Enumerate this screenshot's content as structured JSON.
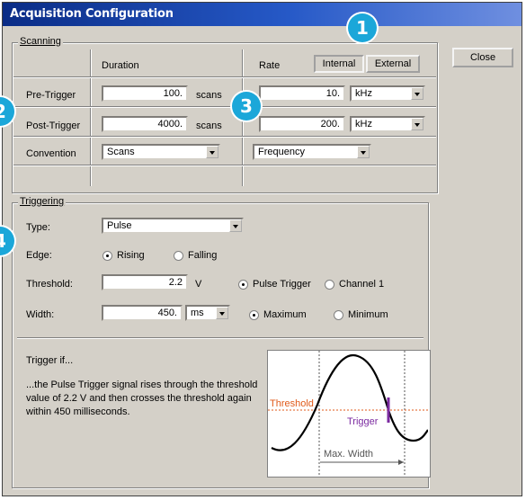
{
  "window": {
    "title": "Acquisition Configuration"
  },
  "scanning": {
    "group_label": "Scanning",
    "col_duration": "Duration",
    "col_rate": "Rate",
    "internal_label": "Internal",
    "external_label": "External",
    "pretrigger": {
      "label": "Pre-Trigger",
      "value": "100.",
      "unit": "scans",
      "rate": "10.",
      "rate_unit": "kHz"
    },
    "posttrigger": {
      "label": "Post-Trigger",
      "value": "4000.",
      "unit": "scans",
      "rate": "200.",
      "rate_unit": "kHz"
    },
    "convention": {
      "label": "Convention",
      "value": "Scans",
      "rate_value": "Frequency"
    }
  },
  "close_label": "Close",
  "triggering": {
    "group_label": "Triggering",
    "type_label": "Type:",
    "type_value": "Pulse",
    "edge_label": "Edge:",
    "rising_label": "Rising",
    "falling_label": "Falling",
    "threshold_label": "Threshold:",
    "threshold_value": "2.2",
    "threshold_unit": "V",
    "pulse_trigger_label": "Pulse Trigger",
    "channel1_label": "Channel 1",
    "width_label": "Width:",
    "width_value": "450.",
    "width_unit": "ms",
    "maximum_label": "Maximum",
    "minimum_label": "Minimum",
    "trigger_if": "Trigger if...",
    "description": "...the Pulse Trigger signal rises through the threshold value of 2.2 V and then crosses the threshold again within 450 milliseconds."
  },
  "diagram": {
    "threshold_label": "Threshold",
    "trigger_label": "Trigger",
    "maxwidth_label": "Max. Width",
    "threshold_color": "#e05a1a",
    "marker_color": "#7b2aa0"
  },
  "badges": [
    "1",
    "2",
    "3",
    "4"
  ],
  "badge_color": "#1ba7d9"
}
